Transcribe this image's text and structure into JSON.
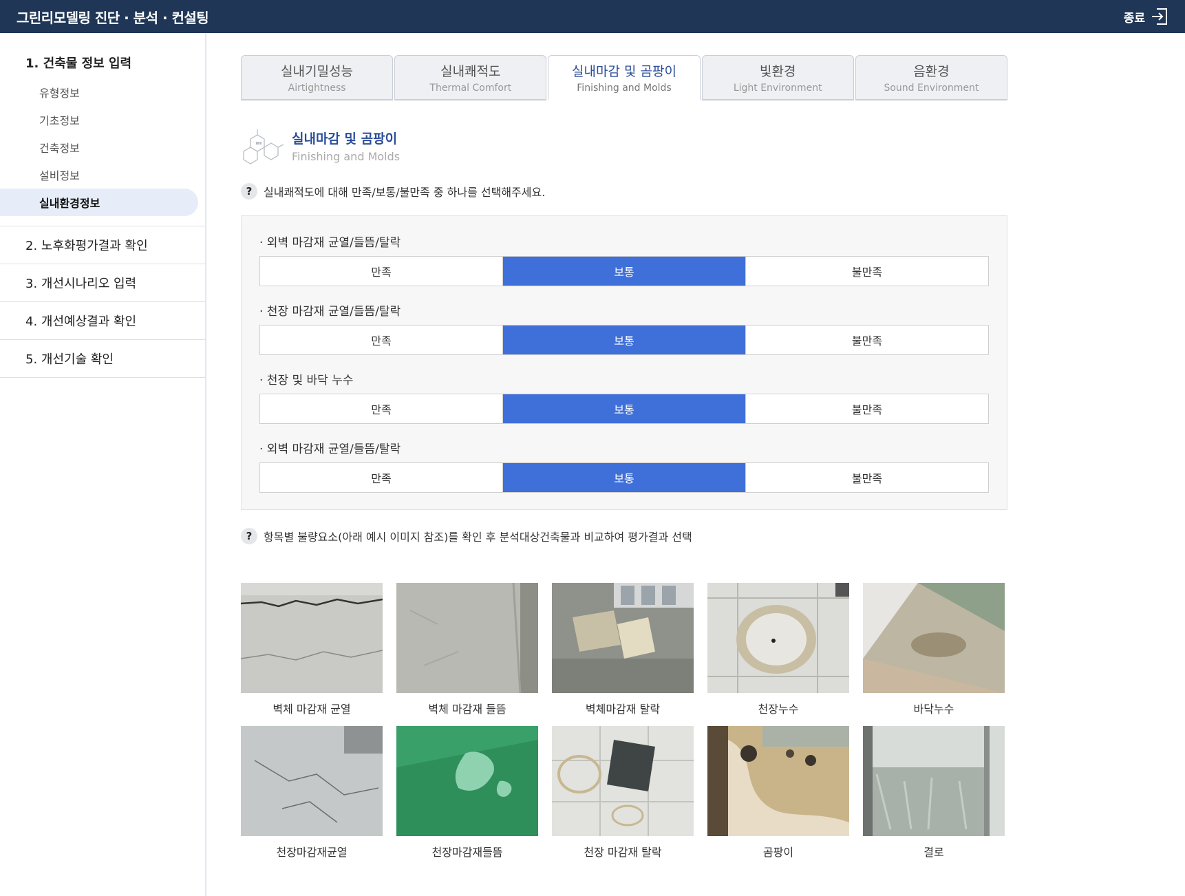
{
  "header": {
    "app_title": "그린리모델링 진단 · 분석 · 컨설팅",
    "exit_label": "종료"
  },
  "sidebar": {
    "groups": [
      {
        "label": "1. 건축물 정보 입력",
        "items": [
          {
            "label": "유형정보"
          },
          {
            "label": "기초정보"
          },
          {
            "label": "건축정보"
          },
          {
            "label": "설비정보"
          },
          {
            "label": "실내환경정보",
            "active": true
          }
        ]
      },
      {
        "label": "2. 노후화평가결과 확인"
      },
      {
        "label": "3. 개선시나리오 입력"
      },
      {
        "label": "4. 개선예상결과 확인"
      },
      {
        "label": "5. 개선기술 확인"
      }
    ]
  },
  "tabs": [
    {
      "ko": "실내기밀성능",
      "en": "Airtightness"
    },
    {
      "ko": "실내쾌적도",
      "en": "Thermal Comfort"
    },
    {
      "ko": "실내마감 및 곰팡이",
      "en": "Finishing and Molds",
      "active": true
    },
    {
      "ko": "빛환경",
      "en": "Light Environment"
    },
    {
      "ko": "음환경",
      "en": "Sound Environment"
    }
  ],
  "section": {
    "title_ko": "실내마감 및 곰팡이",
    "title_en": "Finishing and Molds",
    "icon": "molecule-hexagon-icon"
  },
  "question1": "실내쾌적도에 대해 만족/보통/불만족 중 하나를 선택해주세요.",
  "question2": "항목별 불량요소(아래 예시 이미지 참조)를 확인 후 분석대상건축물과 비교하여 평가결과 선택",
  "options": [
    "만족",
    "보통",
    "불만족"
  ],
  "ratings": [
    {
      "label": "· 외벽 마감재 균열/들뜸/탈락",
      "selected": "보통"
    },
    {
      "label": "· 천장 마감재 균열/들뜸/탈락",
      "selected": "보통"
    },
    {
      "label": "· 천장 및 바닥 누수",
      "selected": "보통"
    },
    {
      "label": "· 외벽 마감재 균열/들뜸/탈락",
      "selected": "보통"
    }
  ],
  "gallery": [
    {
      "caption": "벽체 마감재 균열"
    },
    {
      "caption": "벽체 마감재 들뜸"
    },
    {
      "caption": "벽체마감재 탈락"
    },
    {
      "caption": "천장누수"
    },
    {
      "caption": "바닥누수"
    },
    {
      "caption": "천장마감재균열"
    },
    {
      "caption": "천장마감재들뜸"
    },
    {
      "caption": "천장 마감재 탈락"
    },
    {
      "caption": "곰팡이"
    },
    {
      "caption": "결로"
    }
  ],
  "colors": {
    "header_bg": "#1f3656",
    "accent": "#3f6fd8",
    "active_tab_text": "#2a4d9a",
    "sidebar_active_bg": "#e6edf8"
  }
}
